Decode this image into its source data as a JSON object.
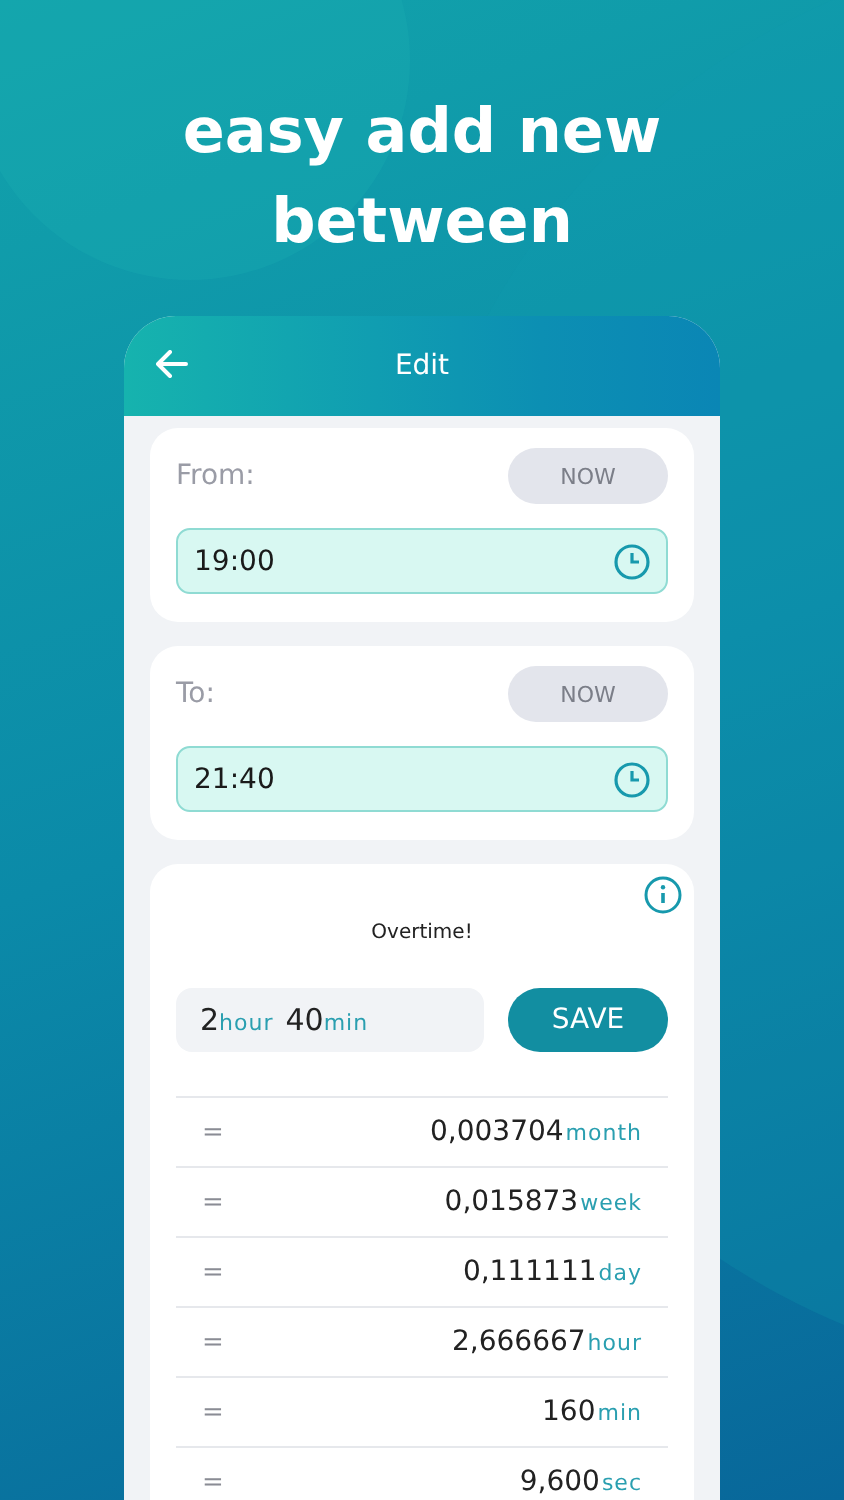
{
  "headline": "easy add new between",
  "header": {
    "title": "Edit"
  },
  "time_cards": [
    {
      "label": "From:",
      "now_button": "NOW",
      "value": "19:00"
    },
    {
      "label": "To:",
      "now_button": "NOW",
      "value": "21:40"
    }
  ],
  "result": {
    "title": "Overtime!",
    "hours": "2",
    "hours_unit": "hour",
    "minutes": "40",
    "minutes_unit": "min",
    "save_button": "SAVE",
    "conversions": [
      {
        "sign": "=",
        "value": "0,003704",
        "unit": "month"
      },
      {
        "sign": "=",
        "value": "0,015873",
        "unit": "week"
      },
      {
        "sign": "=",
        "value": "0,111111",
        "unit": "day"
      },
      {
        "sign": "=",
        "value": "2,666667",
        "unit": "hour"
      },
      {
        "sign": "=",
        "value": "160",
        "unit": "min"
      },
      {
        "sign": "=",
        "value": "9,600",
        "unit": "sec"
      }
    ]
  }
}
